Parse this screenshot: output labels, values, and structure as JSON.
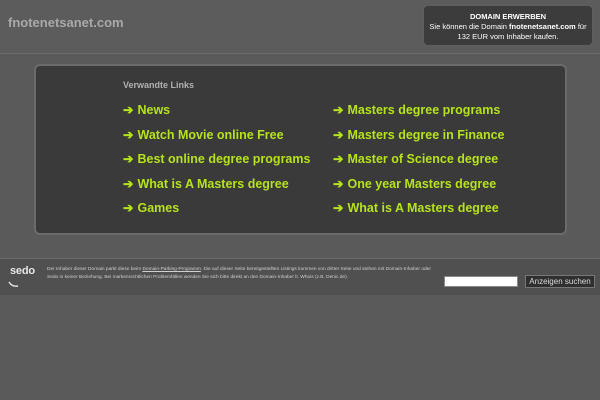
{
  "header": {
    "site_title": "fnotenetsanet.com",
    "domain_offer": {
      "title": "DOMAIN ERWERBEN",
      "line1_prefix": "Sie können die Domain ",
      "domain": "fnotenetsanet.com",
      "line1_suffix": " für",
      "line2": "132 EUR vom Inhaber kaufen."
    }
  },
  "related_links": {
    "heading": "Verwandte Links",
    "arrow": "➔",
    "left": [
      "News",
      "Watch Movie online Free",
      "Best online degree programs",
      "What is A Masters degree",
      "Games"
    ],
    "right": [
      "Masters degree programs",
      "Masters degree in Finance",
      "Master of Science degree",
      "One year Masters degree",
      "What is A Masters degree"
    ]
  },
  "footer": {
    "logo": "sedo",
    "disclaimer_part1": "Der Inhaber dieser Domain parkt diese beim ",
    "disclaimer_link": "Domain-Parking-Programm",
    "disclaimer_part2": ". Die auf dieser Seite bereitgestellten Listings kommen von dritter Seite und stehen mit Domain-Inhaber oder Sedo in keiner Beziehung. Bei markenrechtlichen Problemfällen wenden Sie sich bitte direkt an den Domain-Inhaber lt. Whois (z.B. Denic.de).",
    "search_placeholder": "",
    "search_button": "Anzeigen suchen"
  },
  "colors": {
    "link": "#b6e31c",
    "background": "#5a5a5a",
    "panel": "#3a3a3a"
  }
}
